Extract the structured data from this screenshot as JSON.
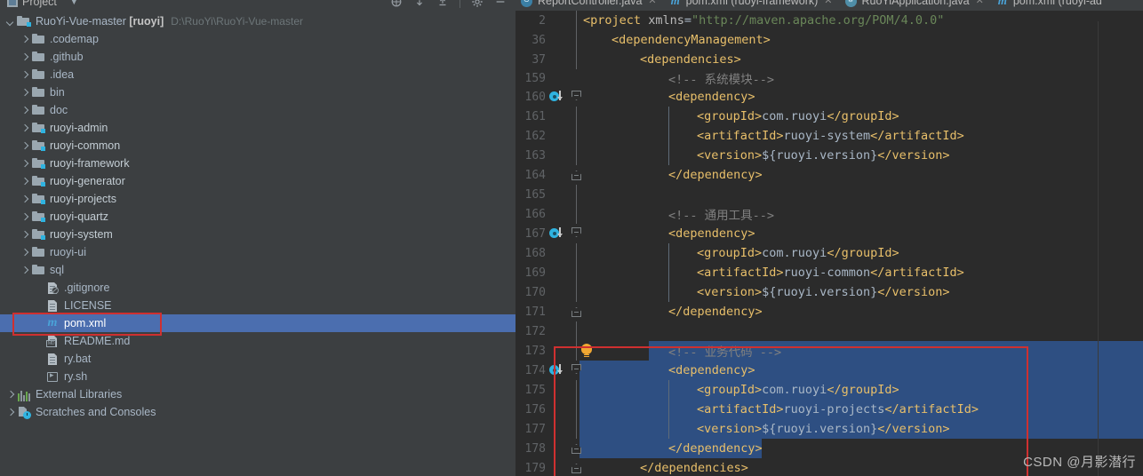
{
  "window": {
    "tool_window_title": "Project",
    "toolbar_icons": [
      "locate-icon",
      "collapse-all-icon",
      "expand-all-icon",
      "settings-gear-icon",
      "hide-icon"
    ]
  },
  "project_tree": {
    "root": {
      "label": "RuoYi-Vue-master",
      "module": "[ruoyi]",
      "path": "D:\\RuoYi\\RuoYi-Vue-master",
      "icon": "project-module-icon",
      "expanded": true
    },
    "items": [
      {
        "label": ".codemap",
        "icon": "folder-icon",
        "arrow": "right",
        "indent": 2
      },
      {
        "label": ".github",
        "icon": "folder-icon",
        "arrow": "right",
        "indent": 2
      },
      {
        "label": ".idea",
        "icon": "folder-icon",
        "arrow": "right",
        "indent": 2
      },
      {
        "label": "bin",
        "icon": "folder-icon",
        "arrow": "right",
        "indent": 2
      },
      {
        "label": "doc",
        "icon": "folder-icon",
        "arrow": "right",
        "indent": 2
      },
      {
        "label": "ruoyi-admin",
        "icon": "module-folder-icon",
        "arrow": "right",
        "indent": 2,
        "bold": true
      },
      {
        "label": "ruoyi-common",
        "icon": "module-folder-icon",
        "arrow": "right",
        "indent": 2,
        "bold": true
      },
      {
        "label": "ruoyi-framework",
        "icon": "module-folder-icon",
        "arrow": "right",
        "indent": 2,
        "bold": true
      },
      {
        "label": "ruoyi-generator",
        "icon": "module-folder-icon",
        "arrow": "right",
        "indent": 2,
        "bold": true
      },
      {
        "label": "ruoyi-projects",
        "icon": "module-folder-icon",
        "arrow": "right",
        "indent": 2,
        "bold": true
      },
      {
        "label": "ruoyi-quartz",
        "icon": "module-folder-icon",
        "arrow": "right",
        "indent": 2,
        "bold": true
      },
      {
        "label": "ruoyi-system",
        "icon": "module-folder-icon",
        "arrow": "right",
        "indent": 2,
        "bold": true
      },
      {
        "label": "ruoyi-ui",
        "icon": "folder-icon",
        "arrow": "right",
        "indent": 2
      },
      {
        "label": "sql",
        "icon": "folder-icon",
        "arrow": "right",
        "indent": 2
      },
      {
        "label": ".gitignore",
        "icon": "gitignore-file-icon",
        "arrow": "none",
        "indent": 3
      },
      {
        "label": "LICENSE",
        "icon": "text-file-icon",
        "arrow": "none",
        "indent": 3
      },
      {
        "label": "pom.xml",
        "icon": "maven-file-icon",
        "arrow": "none",
        "indent": 3,
        "selected": true
      },
      {
        "label": "README.md",
        "icon": "markdown-file-icon",
        "arrow": "none",
        "indent": 3
      },
      {
        "label": "ry.bat",
        "icon": "text-file-icon",
        "arrow": "none",
        "indent": 3
      },
      {
        "label": "ry.sh",
        "icon": "shell-file-icon",
        "arrow": "none",
        "indent": 3
      },
      {
        "label": "External Libraries",
        "icon": "external-libraries-icon",
        "arrow": "right",
        "indent": 1
      },
      {
        "label": "Scratches and Consoles",
        "icon": "scratches-icon",
        "arrow": "right",
        "indent": 1
      }
    ]
  },
  "editor": {
    "tabs": [
      {
        "label": "ReportController.java",
        "icon": "java-class-icon"
      },
      {
        "label": "pom.xml (ruoyi-framework)",
        "icon": "maven-file-icon"
      },
      {
        "label": "RuoYiApplication.java",
        "icon": "spring-boot-icon"
      },
      {
        "label": "pom.xml (ruoyi-ad",
        "icon": "maven-file-icon"
      }
    ],
    "lines": [
      {
        "num": "2",
        "indent": 0,
        "segments": [
          {
            "t": "<",
            "c": "tagc"
          },
          {
            "t": "project",
            "c": "tagc"
          },
          {
            "t": " ",
            "c": "txtc"
          },
          {
            "t": "xmlns",
            "c": "attrn"
          },
          {
            "t": "=",
            "c": "txtc"
          },
          {
            "t": "\"http://maven.apache.org/POM/4.0.0\"",
            "c": "attrv"
          }
        ]
      },
      {
        "num": "36",
        "indent": 1,
        "segments": [
          {
            "t": "<dependencyManagement>",
            "c": "tagc"
          }
        ]
      },
      {
        "num": "37",
        "indent": 2,
        "segments": [
          {
            "t": "<dependencies>",
            "c": "tagc"
          }
        ]
      },
      {
        "num": "159",
        "indent": 3,
        "clipped": true,
        "segments": [
          {
            "t": "<!-- 系统模块-->",
            "c": "cmt"
          }
        ]
      },
      {
        "num": "160",
        "indent": 3,
        "mvn": true,
        "foldTop": true,
        "segments": [
          {
            "t": "<dependency>",
            "c": "tagc"
          }
        ]
      },
      {
        "num": "161",
        "indent": 4,
        "segments": [
          {
            "t": "<groupId>",
            "c": "tagc"
          },
          {
            "t": "com.ruoyi",
            "c": "txtc"
          },
          {
            "t": "</groupId>",
            "c": "tagc"
          }
        ]
      },
      {
        "num": "162",
        "indent": 4,
        "segments": [
          {
            "t": "<artifactId>",
            "c": "tagc"
          },
          {
            "t": "ruoyi-system",
            "c": "txtc"
          },
          {
            "t": "</artifactId>",
            "c": "tagc"
          }
        ]
      },
      {
        "num": "163",
        "indent": 4,
        "segments": [
          {
            "t": "<version>",
            "c": "tagc"
          },
          {
            "t": "${ruoyi.version}",
            "c": "txtc"
          },
          {
            "t": "</version>",
            "c": "tagc"
          }
        ]
      },
      {
        "num": "164",
        "indent": 3,
        "foldBot": true,
        "segments": [
          {
            "t": "</dependency>",
            "c": "tagc"
          }
        ]
      },
      {
        "num": "165",
        "indent": 0,
        "segments": []
      },
      {
        "num": "166",
        "indent": 3,
        "segments": [
          {
            "t": "<!-- 通用工具-->",
            "c": "cmt"
          }
        ]
      },
      {
        "num": "167",
        "indent": 3,
        "mvn": true,
        "foldTop": true,
        "segments": [
          {
            "t": "<dependency>",
            "c": "tagc"
          }
        ]
      },
      {
        "num": "168",
        "indent": 4,
        "segments": [
          {
            "t": "<groupId>",
            "c": "tagc"
          },
          {
            "t": "com.ruoyi",
            "c": "txtc"
          },
          {
            "t": "</groupId>",
            "c": "tagc"
          }
        ]
      },
      {
        "num": "169",
        "indent": 4,
        "segments": [
          {
            "t": "<artifactId>",
            "c": "tagc"
          },
          {
            "t": "ruoyi-common",
            "c": "txtc"
          },
          {
            "t": "</artifactId>",
            "c": "tagc"
          }
        ]
      },
      {
        "num": "170",
        "indent": 4,
        "segments": [
          {
            "t": "<version>",
            "c": "tagc"
          },
          {
            "t": "${ruoyi.version}",
            "c": "txtc"
          },
          {
            "t": "</version>",
            "c": "tagc"
          }
        ]
      },
      {
        "num": "171",
        "indent": 3,
        "foldBot": true,
        "segments": [
          {
            "t": "</dependency>",
            "c": "tagc"
          }
        ]
      },
      {
        "num": "172",
        "indent": 0,
        "segments": []
      },
      {
        "num": "173",
        "indent": 3,
        "bulb": true,
        "segments": [
          {
            "t": "<!-- 业务代码 -->",
            "c": "cmt"
          }
        ]
      },
      {
        "num": "174",
        "indent": 3,
        "mvn": true,
        "foldTop": true,
        "segments": [
          {
            "t": "<dependency>",
            "c": "tagc"
          }
        ]
      },
      {
        "num": "175",
        "indent": 4,
        "segments": [
          {
            "t": "<groupId>",
            "c": "tagc"
          },
          {
            "t": "com.ruoyi",
            "c": "txtc"
          },
          {
            "t": "</groupId>",
            "c": "tagc"
          }
        ]
      },
      {
        "num": "176",
        "indent": 4,
        "segments": [
          {
            "t": "<artifactId>",
            "c": "tagc"
          },
          {
            "t": "ruoyi-projects",
            "c": "txtc"
          },
          {
            "t": "</artifactId>",
            "c": "tagc"
          }
        ]
      },
      {
        "num": "177",
        "indent": 4,
        "segments": [
          {
            "t": "<version>",
            "c": "tagc"
          },
          {
            "t": "${ruoyi.version}",
            "c": "txtc"
          },
          {
            "t": "</version>",
            "c": "tagc"
          }
        ]
      },
      {
        "num": "178",
        "indent": 3,
        "foldBot": true,
        "segments": [
          {
            "t": "</dependency>",
            "c": "tagc"
          }
        ]
      },
      {
        "num": "179",
        "indent": 2,
        "foldBot": true,
        "segments": [
          {
            "t": "</dependencies>",
            "c": "tagc"
          }
        ]
      }
    ]
  },
  "annotations": {
    "tree_highlight_target": "pom.xml",
    "code_highlight_start_line": "173",
    "code_highlight_end_line": "179",
    "box_color": "#cf3030"
  },
  "watermark": "CSDN @月影潜行",
  "colors": {
    "panel_bg": "#3c3f41",
    "editor_bg": "#2b2b2b",
    "selection_blue": "#2e4f82",
    "tree_selection_blue": "#4b6eaf",
    "tag": "#e8bf6a",
    "text": "#a9b7c6",
    "comment": "#808080",
    "attr_value": "#6a8759",
    "accent_cyan": "#2fb3e0"
  }
}
